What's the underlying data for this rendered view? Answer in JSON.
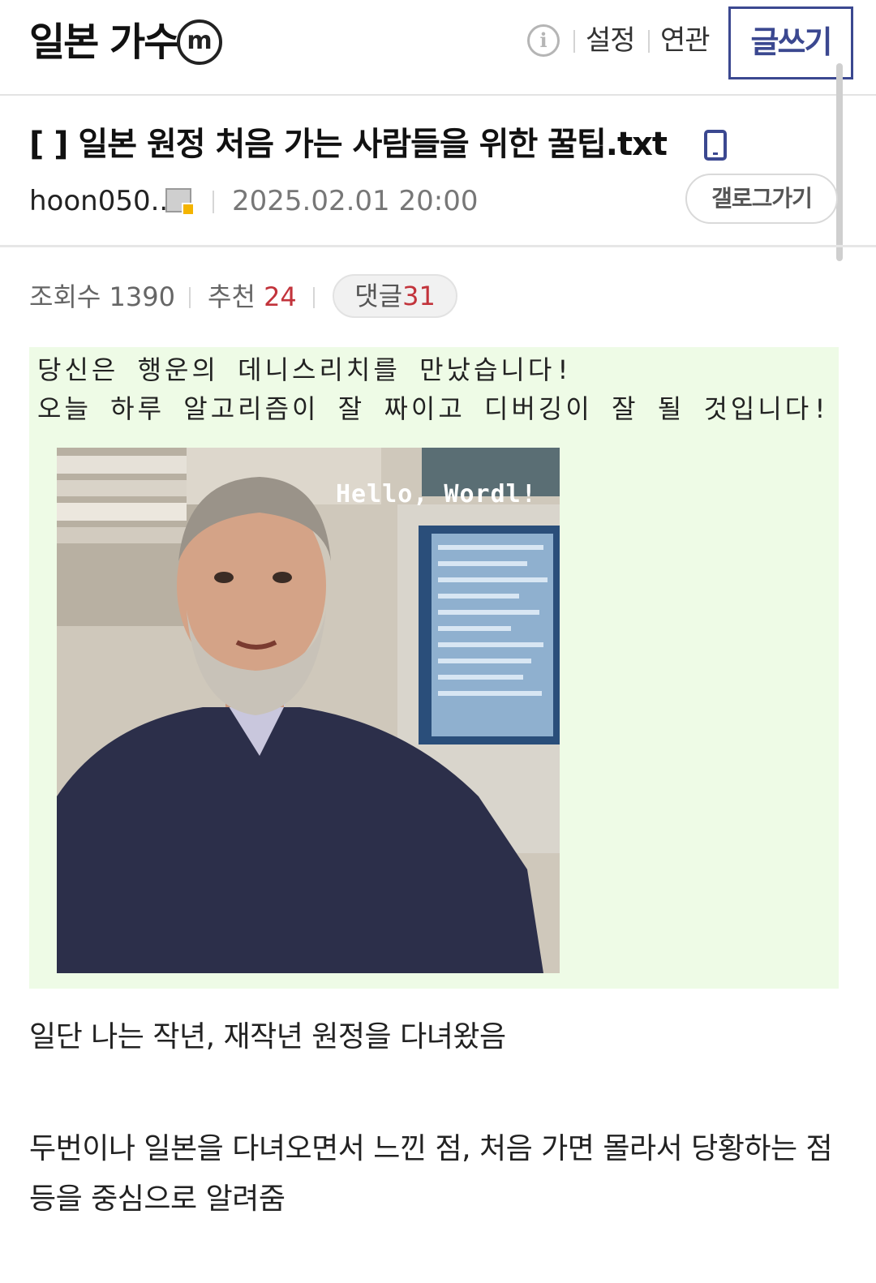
{
  "header": {
    "gallery_title": "일본 가수",
    "minor_badge": "m",
    "info_icon": "info-icon",
    "settings_label": "설정",
    "related_label": "연관",
    "write_label": "글쓰기"
  },
  "post": {
    "title": "[ ] 일본 원정 처음 가는 사람들을 위한 꿀팁.txt",
    "author": "hoon050..",
    "date": "2025.02.01 20:00",
    "gallery_button": "갤로그가기",
    "views_label": "조회수",
    "views": "1390",
    "recommend_label": "추천",
    "recommend": "24",
    "comments_label": "댓글",
    "comments": "31"
  },
  "image": {
    "fortune_line_1": "당신은 행운의 데니스리치를 만났습니다!",
    "fortune_line_2": "오늘 하루 알고리즘이 잘 짜이고 디버깅이 잘 될 것입니다!",
    "caption": "Hello, Wordl!"
  },
  "body": {
    "paragraph_1": "일단 나는 작년, 재작년 원정을 다녀왔음",
    "paragraph_2": "두번이나 일본을 다녀오면서 느낀 점, 처음 가면 몰라서 당황하는 점 등을 중심으로 알려줌"
  },
  "colors": {
    "accent": "#3b4890",
    "count_red": "#c2333b",
    "image_bg": "#eefbe6"
  }
}
